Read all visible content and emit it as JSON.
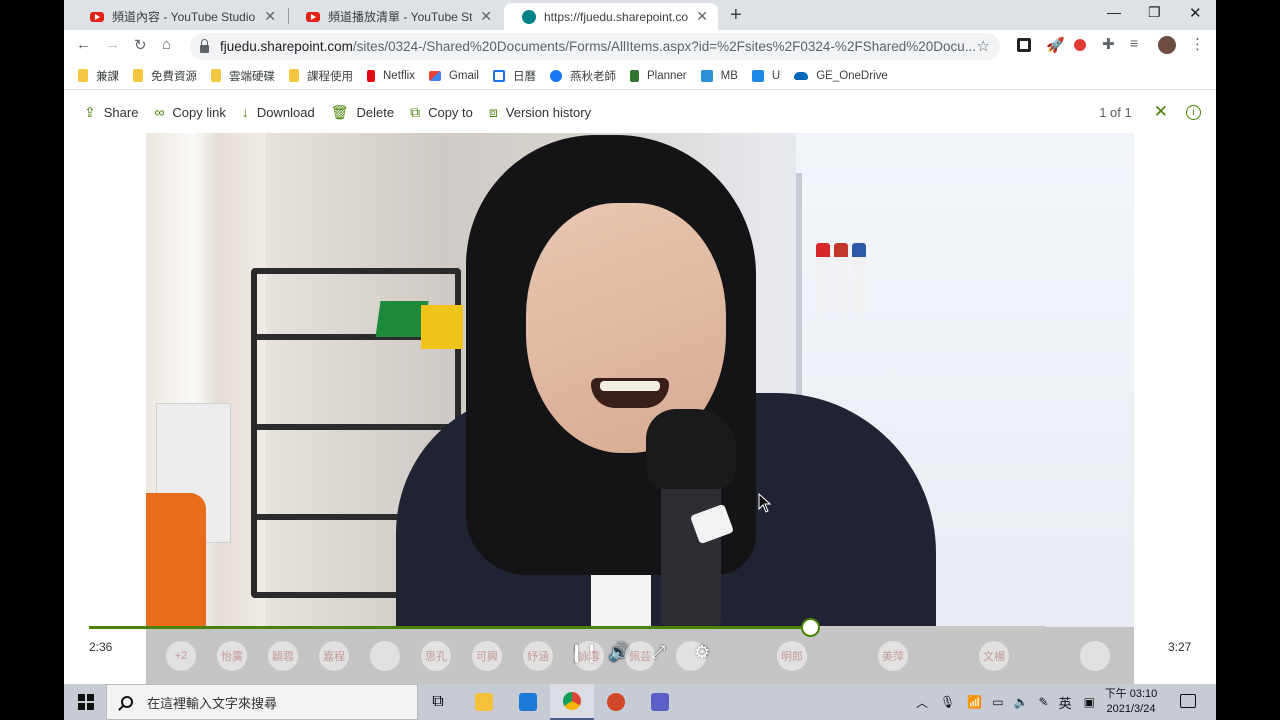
{
  "browser": {
    "tabs": [
      {
        "title": "頻道內容 - YouTube Studio",
        "active": false
      },
      {
        "title": "頻道播放清單 - YouTube Studio",
        "active": false
      },
      {
        "title": "https://fjuedu.sharepoint.com/",
        "active": true
      }
    ],
    "url_host": "fjuedu.sharepoint.com",
    "url_rest": "/sites/0324-/Shared%20Documents/Forms/AllItems.aspx?id=%2Fsites%2F0324-%2FShared%20Docu...",
    "bookmarks": [
      {
        "label": "兼課",
        "icon": "folder-icon",
        "color": "#f5c842"
      },
      {
        "label": "免費資源",
        "icon": "folder-icon",
        "color": "#f5c842"
      },
      {
        "label": "雲端硬碟",
        "icon": "folder-icon",
        "color": "#f5c842"
      },
      {
        "label": "課程使用",
        "icon": "folder-icon",
        "color": "#f5c842"
      },
      {
        "label": "Netflix",
        "icon": "netflix-icon",
        "color": "#e50914"
      },
      {
        "label": "Gmail",
        "icon": "gmail-icon",
        "color": "#ea4335"
      },
      {
        "label": "日曆",
        "icon": "calendar-icon",
        "color": "#1a73e8"
      },
      {
        "label": "燕秋老師",
        "icon": "facebook-icon",
        "color": "#1877f2"
      },
      {
        "label": "Planner",
        "icon": "planner-icon",
        "color": "#31752f"
      },
      {
        "label": "MB",
        "icon": "music-icon",
        "color": "#2b8fd6"
      },
      {
        "label": "U",
        "icon": "u-icon",
        "color": "#1e88e5"
      },
      {
        "label": "GE_OneDrive",
        "icon": "onedrive-icon",
        "color": "#0364b8"
      }
    ]
  },
  "toolbar": {
    "share": "Share",
    "copy_link": "Copy link",
    "download": "Download",
    "delete": "Delete",
    "copy_to": "Copy to",
    "version_history": "Version history",
    "counter": "1 of 1"
  },
  "player": {
    "current_time": "2:36",
    "duration": "3:27",
    "progress_fraction": 0.7536
  },
  "participants": [
    "+2",
    "怡霙",
    "穎蓉",
    "嘉程",
    "",
    "思孔",
    "可興",
    "妤涵",
    "詠蓉",
    "佩芸",
    "",
    "明郎",
    "美萍",
    "文楊",
    ""
  ],
  "taskbar": {
    "search_placeholder": "在這裡輸入文字來搜尋",
    "ime": "英",
    "time": "下午 03:10",
    "date": "2021/3/24"
  },
  "colors": {
    "accent": "#498205",
    "tabstrip": "#dee1e6",
    "taskbar": "#c6cbd4"
  }
}
